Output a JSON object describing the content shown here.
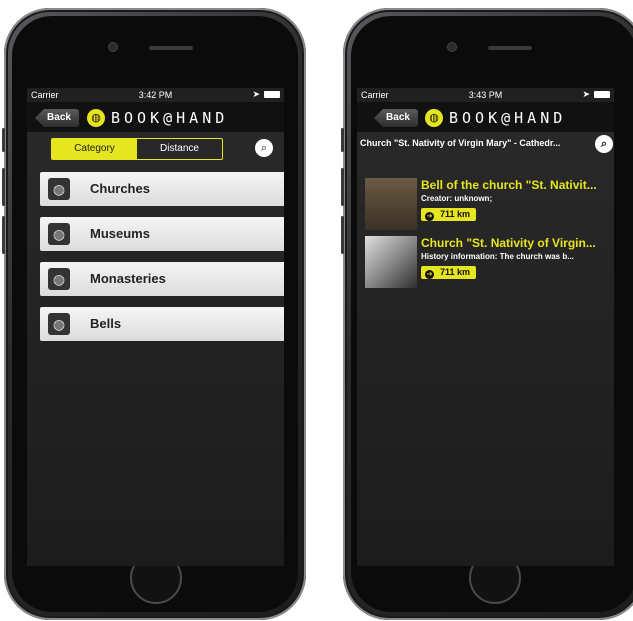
{
  "left": {
    "status": {
      "carrier": "Carrier",
      "time": "3:42 PM"
    },
    "nav": {
      "back_label": "Back",
      "logo_text": "BOOK@HAND"
    },
    "segments": [
      "Category",
      "Distance"
    ],
    "categories": [
      {
        "label": "Churches"
      },
      {
        "label": "Museums"
      },
      {
        "label": "Monasteries"
      },
      {
        "label": "Bells"
      }
    ]
  },
  "right": {
    "status": {
      "carrier": "Carrier",
      "time": "3:43 PM"
    },
    "nav": {
      "back_label": "Back",
      "logo_text": "BOOK@HAND"
    },
    "title": "Church \"St. Nativity of Virgin Mary\" - Cathedr...",
    "items": [
      {
        "title": "Bell of the church \"St. Nativit...",
        "subtitle": "Creator: unknown;",
        "distance": "711 km"
      },
      {
        "title": "Church \"St. Nativity of Virgin...",
        "subtitle": "History information: The church was b...",
        "distance": "711 km"
      }
    ]
  },
  "colors": {
    "accent": "#e5e520",
    "background": "#1c1c1c"
  }
}
